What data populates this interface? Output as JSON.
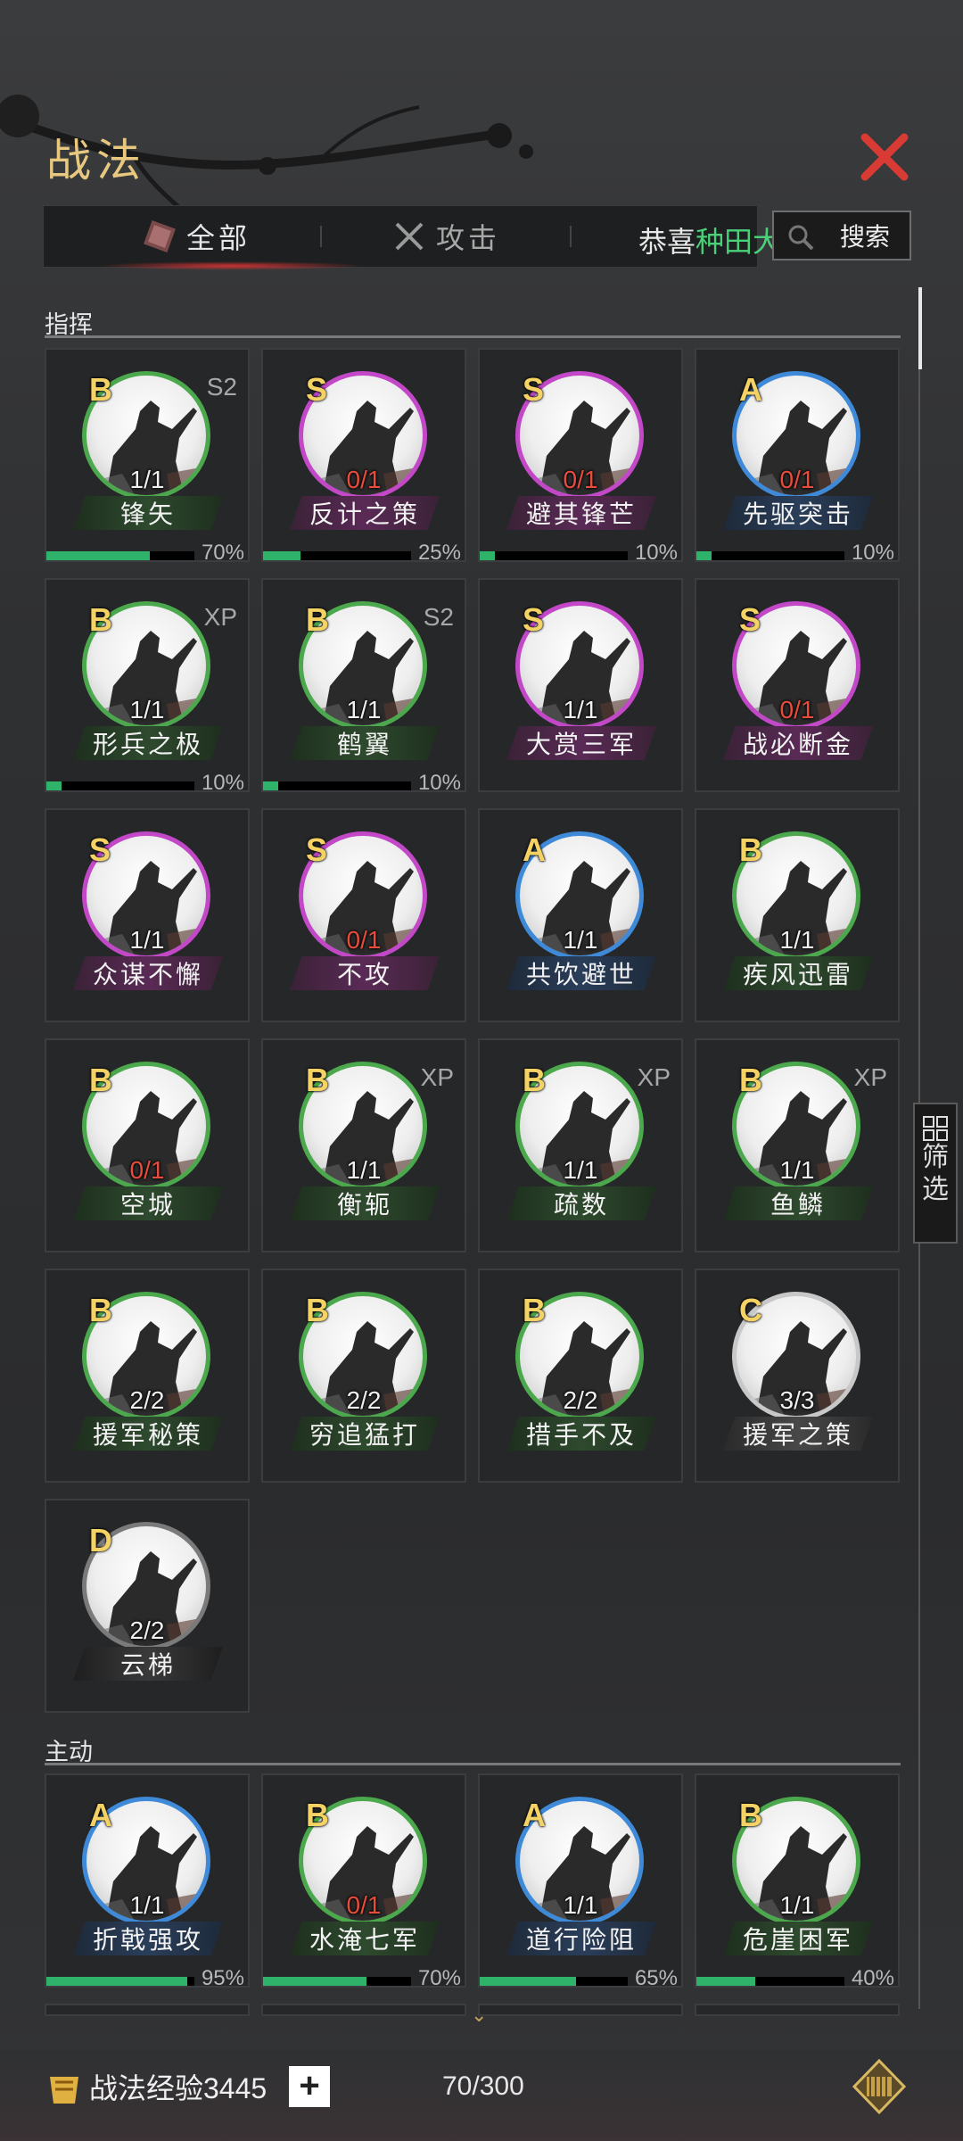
{
  "header": {
    "title": "战法",
    "close_icon": "close-x-icon"
  },
  "tabs": [
    {
      "label": "全部",
      "active": true,
      "icon": "all-icon"
    },
    {
      "label": "攻击",
      "active": false,
      "icon": "crossed-swords-icon"
    }
  ],
  "notice": {
    "prefix": "恭喜",
    "highlight": "种田大队"
  },
  "search": {
    "label": "搜索"
  },
  "sections": {
    "command": "指挥",
    "active": "主动"
  },
  "colors": {
    "S": "#c248c8",
    "A": "#3f8ad8",
    "B": "#4ca84c",
    "C": "#c8c8c8",
    "D": "#7a7a7a",
    "accent": "#e8c87e",
    "close": "#d83a34"
  },
  "command_cards": [
    {
      "grade": "B",
      "tag": "S2",
      "count": "1/1",
      "name": "锋矢",
      "progress": 70,
      "pct": "70%"
    },
    {
      "grade": "S",
      "tag": "",
      "count": "0/1",
      "name": "反计之策",
      "progress": 25,
      "pct": "25%"
    },
    {
      "grade": "S",
      "tag": "",
      "count": "0/1",
      "name": "避其锋芒",
      "progress": 10,
      "pct": "10%"
    },
    {
      "grade": "A",
      "tag": "",
      "count": "0/1",
      "name": "先驱突击",
      "progress": 10,
      "pct": "10%"
    },
    {
      "grade": "B",
      "tag": "XP",
      "count": "1/1",
      "name": "形兵之极",
      "progress": 10,
      "pct": "10%"
    },
    {
      "grade": "B",
      "tag": "S2",
      "count": "1/1",
      "name": "鹤翼",
      "progress": 10,
      "pct": "10%"
    },
    {
      "grade": "S",
      "tag": "",
      "count": "1/1",
      "name": "大赏三军",
      "progress": null,
      "pct": ""
    },
    {
      "grade": "S",
      "tag": "",
      "count": "0/1",
      "name": "战必断金",
      "progress": null,
      "pct": ""
    },
    {
      "grade": "S",
      "tag": "",
      "count": "1/1",
      "name": "众谋不懈",
      "progress": null,
      "pct": ""
    },
    {
      "grade": "S",
      "tag": "",
      "count": "0/1",
      "name": "不攻",
      "progress": null,
      "pct": ""
    },
    {
      "grade": "A",
      "tag": "",
      "count": "1/1",
      "name": "共饮避世",
      "progress": null,
      "pct": ""
    },
    {
      "grade": "B",
      "tag": "",
      "count": "1/1",
      "name": "疾风迅雷",
      "progress": null,
      "pct": ""
    },
    {
      "grade": "B",
      "tag": "",
      "count": "0/1",
      "name": "空城",
      "progress": null,
      "pct": ""
    },
    {
      "grade": "B",
      "tag": "XP",
      "count": "1/1",
      "name": "衡轭",
      "progress": null,
      "pct": ""
    },
    {
      "grade": "B",
      "tag": "XP",
      "count": "1/1",
      "name": "疏数",
      "progress": null,
      "pct": ""
    },
    {
      "grade": "B",
      "tag": "XP",
      "count": "1/1",
      "name": "鱼鳞",
      "progress": null,
      "pct": ""
    },
    {
      "grade": "B",
      "tag": "",
      "count": "2/2",
      "name": "援军秘策",
      "progress": null,
      "pct": ""
    },
    {
      "grade": "B",
      "tag": "",
      "count": "2/2",
      "name": "穷追猛打",
      "progress": null,
      "pct": ""
    },
    {
      "grade": "B",
      "tag": "",
      "count": "2/2",
      "name": "措手不及",
      "progress": null,
      "pct": ""
    },
    {
      "grade": "C",
      "tag": "",
      "count": "3/3",
      "name": "援军之策",
      "progress": null,
      "pct": ""
    },
    {
      "grade": "D",
      "tag": "",
      "count": "2/2",
      "name": "云梯",
      "progress": null,
      "pct": ""
    }
  ],
  "active_cards": [
    {
      "grade": "A",
      "tag": "",
      "count": "1/1",
      "name": "折戟强攻",
      "progress": 95,
      "pct": "95%"
    },
    {
      "grade": "B",
      "tag": "",
      "count": "0/1",
      "name": "水淹七军",
      "progress": 70,
      "pct": "70%"
    },
    {
      "grade": "A",
      "tag": "",
      "count": "1/1",
      "name": "道行险阻",
      "progress": 65,
      "pct": "65%"
    },
    {
      "grade": "B",
      "tag": "",
      "count": "1/1",
      "name": "危崖困军",
      "progress": 40,
      "pct": "40%"
    }
  ],
  "filter": {
    "line1": "筛",
    "line2": "选",
    "icon": "grid-icon"
  },
  "footer": {
    "exp_label": "战法经验3445",
    "slots": "70/300",
    "exp_icon": "fist-icon",
    "bag_icon": "scroll-case-icon"
  }
}
